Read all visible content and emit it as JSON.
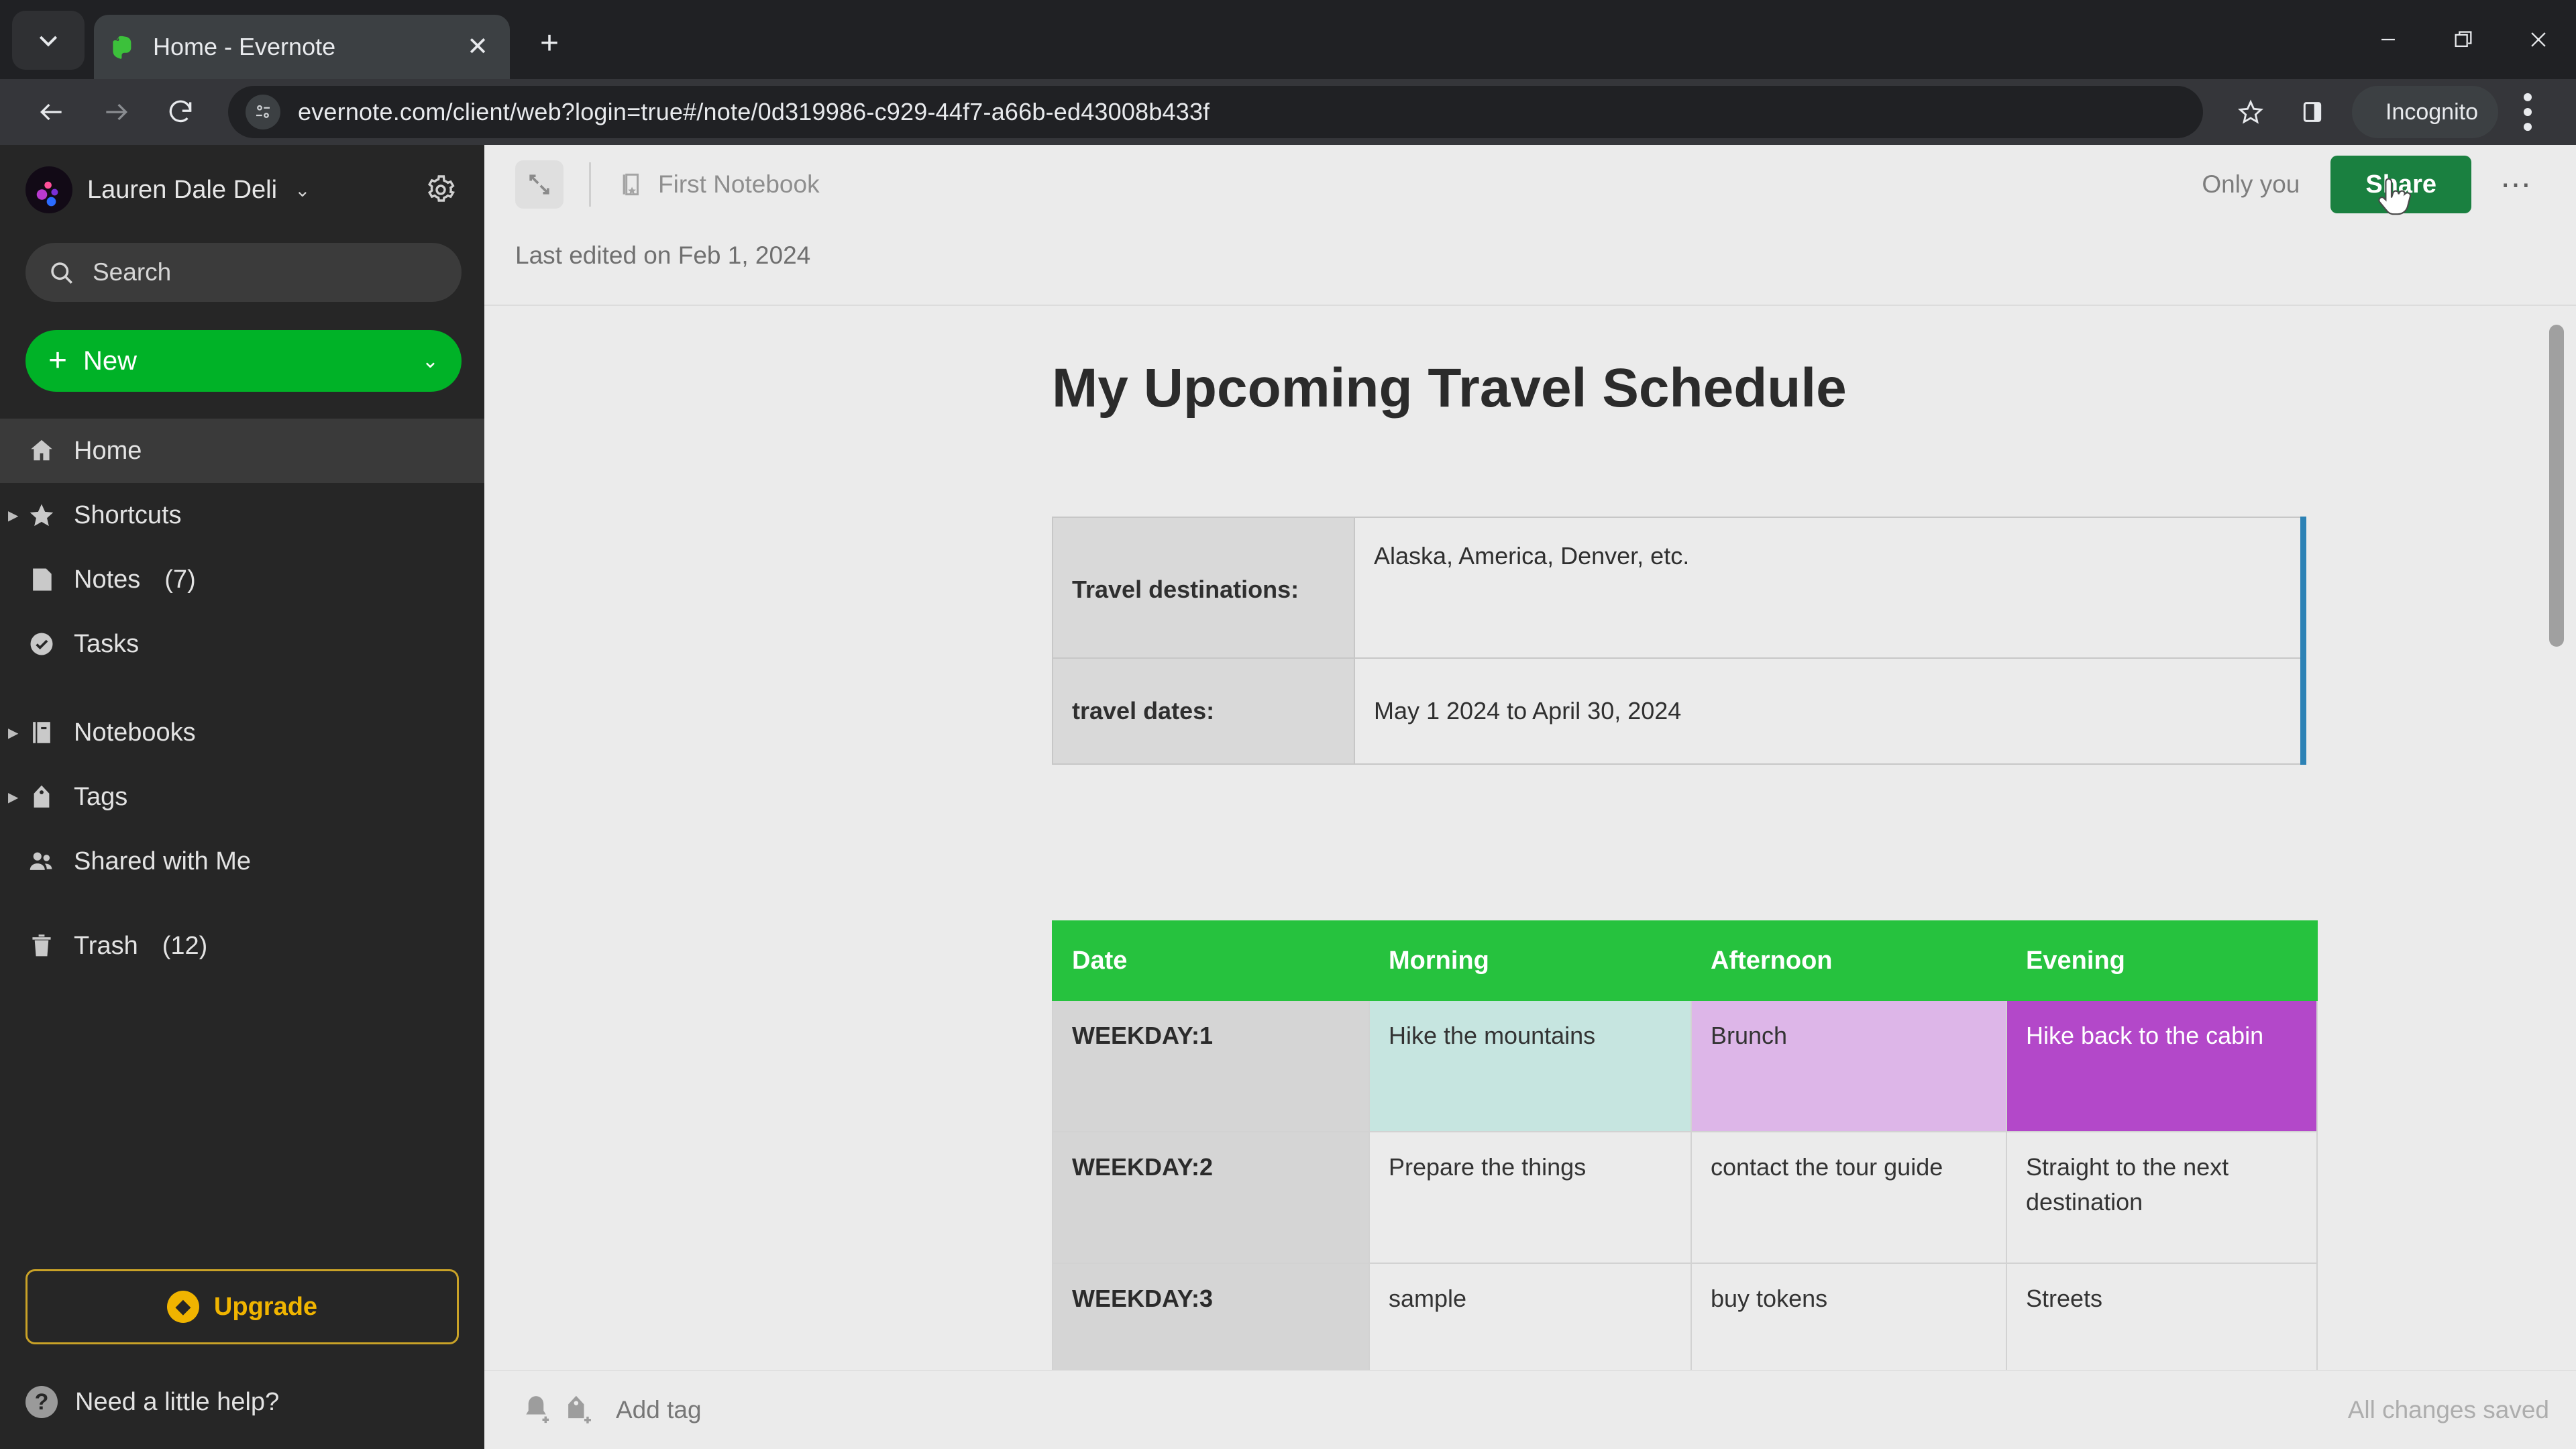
{
  "browser": {
    "tab_search_icon": "chevron-down-icon",
    "tab": {
      "title": "Home - Evernote",
      "favicon": "evernote-elephant-icon",
      "close_label": "✕"
    },
    "new_tab_label": "+",
    "window_controls": {
      "minimize": "minimize-icon",
      "maximize": "maximize-icon",
      "close": "close-icon"
    },
    "nav": {
      "back": "back-arrow-icon",
      "forward": "forward-arrow-icon",
      "reload": "reload-icon"
    },
    "omnibox": {
      "site_info_icon": "site-settings-icon",
      "url": "evernote.com/client/web?login=true#/note/0d319986-c929-44f7-a66b-ed43008b433f"
    },
    "bookmark_icon": "star-icon",
    "sidepanel_icon": "side-panel-icon",
    "profile": {
      "label": "Incognito",
      "icon": "incognito-hat-icon"
    },
    "menu_icon": "three-dot-menu-icon"
  },
  "sidebar": {
    "account": {
      "name": "Lauren Dale Deli",
      "caret": "⌄",
      "avatar": "user-avatar",
      "settings_icon": "gear-icon"
    },
    "search": {
      "placeholder": "Search",
      "icon": "search-icon"
    },
    "new_button": {
      "label": "New",
      "plus": "+",
      "chevron": "⌄"
    },
    "items": [
      {
        "label": "Home",
        "icon": "home-icon",
        "count": "",
        "expandable": false,
        "active": true
      },
      {
        "label": "Shortcuts",
        "icon": "star-icon",
        "count": "",
        "expandable": true,
        "active": false
      },
      {
        "label": "Notes",
        "icon": "notes-icon",
        "count": "(7)",
        "expandable": false,
        "active": false
      },
      {
        "label": "Tasks",
        "icon": "check-circle-icon",
        "count": "",
        "expandable": false,
        "active": false
      },
      {
        "label": "Notebooks",
        "icon": "notebook-icon",
        "count": "",
        "expandable": true,
        "active": false
      },
      {
        "label": "Tags",
        "icon": "tag-icon",
        "count": "",
        "expandable": true,
        "active": false
      },
      {
        "label": "Shared with Me",
        "icon": "people-icon",
        "count": "",
        "expandable": false,
        "active": false
      },
      {
        "label": "Trash",
        "icon": "trash-icon",
        "count": "(12)",
        "expandable": false,
        "active": false
      }
    ],
    "upgrade": {
      "label": "Upgrade",
      "icon": "bolt-icon",
      "color": "#f0b400"
    },
    "help": {
      "label": "Need a little help?",
      "icon": "question-mark-icon"
    }
  },
  "note_toolbar": {
    "expand_icon": "expand-note-icon",
    "notebook": {
      "label": "First Notebook",
      "icon": "notebook-icon"
    },
    "permission_label": "Only you",
    "share_label": "Share",
    "share_color": "#1a8040",
    "more_icon": "three-dot-menu-icon"
  },
  "note": {
    "last_edited": "Last edited on Feb 1, 2024",
    "title": "My Upcoming Travel Schedule",
    "info_table": {
      "accent_color": "#2d82b5",
      "rows": [
        {
          "key": "Travel destinations:",
          "value": "Alaska, America, Denver, etc."
        },
        {
          "key": "travel dates:",
          "value": "May 1 2024 to April 30, 2024"
        }
      ]
    },
    "schedule_table": {
      "header_color": "#26c23e",
      "headers": [
        "Date",
        "Morning",
        "Afternoon",
        "Evening"
      ],
      "rows": [
        {
          "date": "WEEKDAY:1",
          "morning": "Hike the mountains",
          "afternoon": "Brunch",
          "evening": "Hike back to the cabin"
        },
        {
          "date": "WEEKDAY:2",
          "morning": "Prepare the things",
          "afternoon": "contact the tour guide",
          "evening": "Straight to the next destination"
        },
        {
          "date": "WEEKDAY:3",
          "morning": "sample",
          "afternoon": "buy tokens",
          "evening": "Streets"
        }
      ]
    }
  },
  "footer": {
    "reminder_icon": "add-reminder-icon",
    "tag_icon": "add-tag-icon",
    "add_tag_label": "Add tag",
    "status": "All changes saved"
  }
}
